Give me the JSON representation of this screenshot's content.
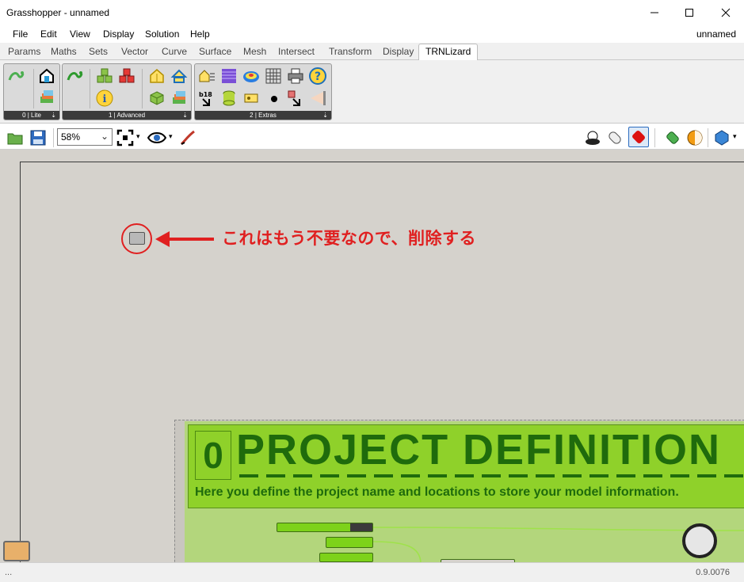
{
  "window": {
    "title": "Grasshopper - unnamed"
  },
  "menu": {
    "items": [
      "File",
      "Edit",
      "View",
      "Display",
      "Solution",
      "Help"
    ],
    "document_name": "unnamed"
  },
  "tabs": {
    "items": [
      "Params",
      "Maths",
      "Sets",
      "Vector",
      "Curve",
      "Surface",
      "Mesh",
      "Intersect",
      "Transform",
      "Display",
      "TRNLizard"
    ],
    "active": "TRNLizard"
  },
  "ribbon": {
    "panels": [
      {
        "label": "0 | Lite"
      },
      {
        "label": "1 | Advanced"
      },
      {
        "label": "2 | Extras"
      }
    ],
    "badge_b18": "b18"
  },
  "toolbar": {
    "zoom": "58%"
  },
  "canvas": {
    "annotation": "これはもう不要なので、削除する",
    "group": {
      "number": "0",
      "title": "PROJECT DEFINITION",
      "subtitle": "Here you define the project name and locations to store your model information."
    }
  },
  "status": {
    "left": "...",
    "version": "0.9.0076"
  },
  "colors": {
    "accent_red": "#e02020",
    "group_green": "#8fd12a",
    "group_text": "#1f6b0c",
    "canvas": "#d5d2cc"
  }
}
